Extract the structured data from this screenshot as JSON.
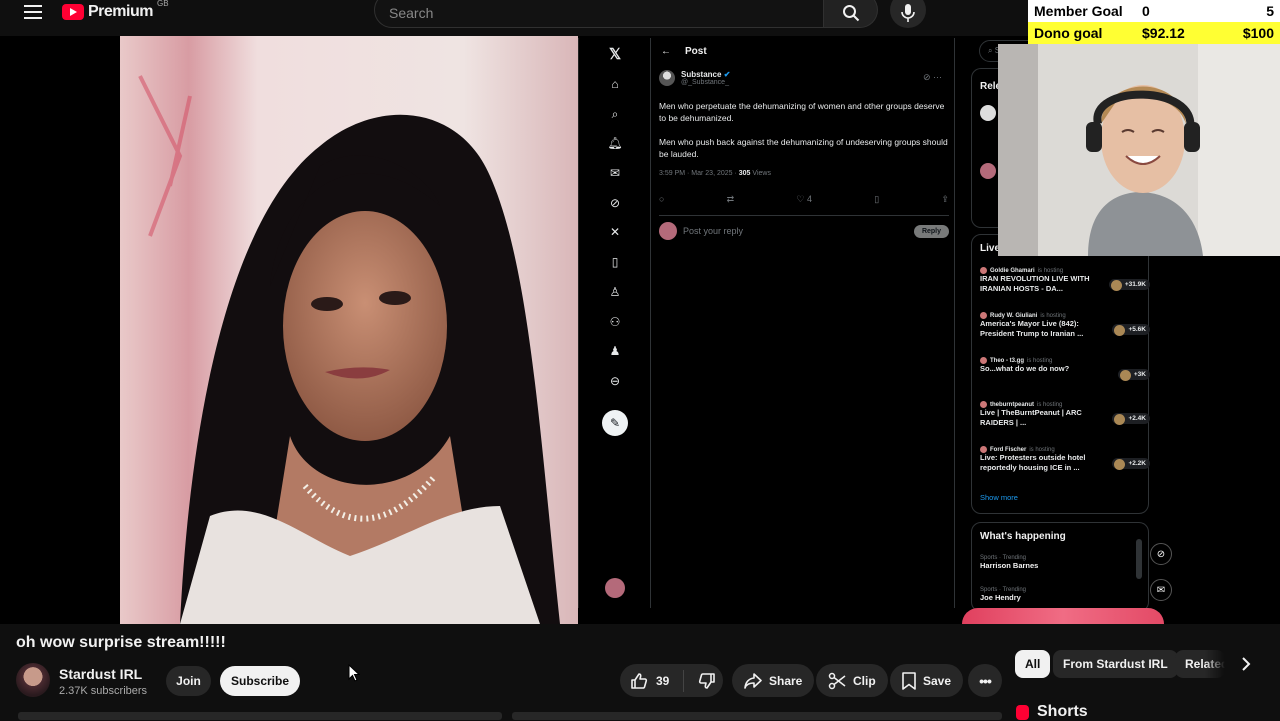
{
  "youtube": {
    "logo_text": "Premium",
    "logo_region": "GB",
    "search_placeholder": "Search",
    "video_title": "oh wow surprise stream!!!!!",
    "channel_name": "Stardust IRL",
    "subscribers": "2.37K subscribers",
    "join_label": "Join",
    "subscribe_label": "Subscribe",
    "like_count": "39",
    "share_label": "Share",
    "clip_label": "Clip",
    "save_label": "Save",
    "chips": [
      "All",
      "From Stardust IRL",
      "Related"
    ],
    "shorts_label": "Shorts"
  },
  "goals": {
    "member_label": "Member Goal",
    "member_current": "0",
    "member_target": "5",
    "dono_label": "Dono goal",
    "dono_current": "$92.12",
    "dono_target": "$100"
  },
  "x_post": {
    "header": "Post",
    "author_name": "Substance",
    "author_handle": "@_Substance_",
    "text_1": "Men who perpetuate the dehumanizing of women and other groups deserve to be dehumanized.",
    "text_2": "Men who push back against the dehumanizing of undeserving groups should be lauded.",
    "meta_time": "3:59 PM · Mar 23, 2025 · ",
    "meta_views_count": "305",
    "meta_views_label": " Views",
    "likes": "4",
    "reply_placeholder": "Post your reply",
    "reply_button": "Reply"
  },
  "x_sidebar": {
    "search_stub": "Se",
    "relevant_stub": "Rele",
    "live_heading": "Live",
    "live_items": [
      {
        "host": "Goldie Ghamari",
        "status": "is hosting",
        "title": "IRAN REVOLUTION LIVE WITH IRANIAN HOSTS - DA...",
        "count": "+31.9K"
      },
      {
        "host": "Rudy W. Giuliani",
        "status": "is hosting",
        "title": "America's Mayor Live (842): President Trump to Iranian ...",
        "count": "+5.6K"
      },
      {
        "host": "Theo - t3.gg",
        "status": "is hosting",
        "title": "So...what do we do now?",
        "count": "+3K"
      },
      {
        "host": "theburntpeanut",
        "status": "is hosting",
        "title": "Live | TheBurntPeanut | ARC RAIDERS | ...",
        "count": "+2.4K"
      },
      {
        "host": "Ford Fischer",
        "status": "is hosting",
        "title": "Live: Protesters outside hotel reportedly housing ICE in ...",
        "count": "+2.2K"
      }
    ],
    "show_more": "Show more",
    "happening_heading": "What's happening",
    "trends": [
      {
        "category": "Sports · Trending",
        "name": "Harrison Barnes"
      },
      {
        "category": "Sports · Trending",
        "name": "Joe Hendry"
      }
    ]
  },
  "colors": {
    "yt_red": "#ff0033",
    "goal_yellow": "#ffff33",
    "x_blue": "#1d9bf0"
  }
}
